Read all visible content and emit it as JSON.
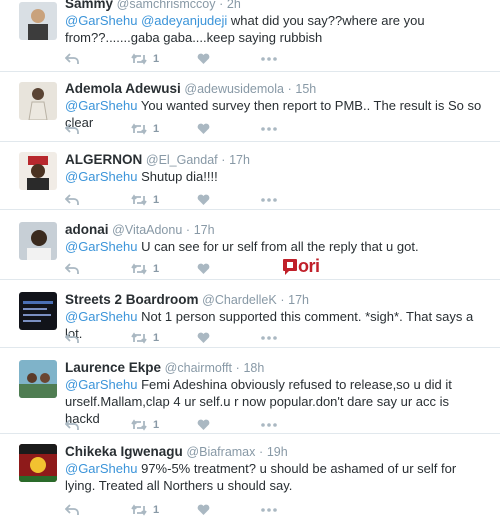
{
  "colors": {
    "accent": "#3b94d9",
    "meta": "#8899a6",
    "text": "#292f33",
    "ori_red": "#c0202a"
  },
  "tweets": [
    {
      "name": "Sammy",
      "handle": "@samchrismccoy",
      "time": "2h",
      "mention": "@GarShehu",
      "mention2": "@adeyanjudeji",
      "text": "what did you say??where are you from??.......gaba gaba....keep saying rubbish",
      "retweets": "1"
    },
    {
      "name": "Ademola Adewusi",
      "handle": "@adewusidemola",
      "time": "15h",
      "mention": "@GarShehu",
      "text": "You wanted survey then report to PMB.. The result is So so clear",
      "retweets": "1"
    },
    {
      "name": "ALGERNON",
      "handle": "@El_Gandaf",
      "time": "17h",
      "mention": "@GarShehu",
      "text": "Shutup dia!!!!",
      "retweets": "1"
    },
    {
      "name": "adonai",
      "handle": "@VitaAdonu",
      "time": "17h",
      "mention": "@GarShehu",
      "text": "U can see for ur self from all the reply  that u got.",
      "retweets": "1",
      "watermark": "ori"
    },
    {
      "name": "Streets 2 Boardroom",
      "handle": "@ChardelleK",
      "time": "17h",
      "mention": "@GarShehu",
      "text": "Not 1 person supported this comment. *sigh*. That says a lot.",
      "retweets": "1"
    },
    {
      "name": "Laurence Ekpe",
      "handle": "@chairmofft",
      "time": "18h",
      "mention": "@GarShehu",
      "text": "Femi Adeshina obviously refused to release,so u did it urself.Mallam,clap 4 ur self.u r now popular.don't dare say ur acc is hackd",
      "retweets": "1"
    },
    {
      "name": "Chikeka Igwenagu",
      "handle": "@Biaframax",
      "time": "19h",
      "mention": "@GarShehu",
      "text": "97%-5% treatment? u should be ashamed of ur self for lying. Treated all Northers u should say.",
      "retweets": "1"
    }
  ],
  "icons": {
    "reply": "reply-icon",
    "retweet": "retweet-icon",
    "like": "heart-icon",
    "more": "more-icon"
  }
}
